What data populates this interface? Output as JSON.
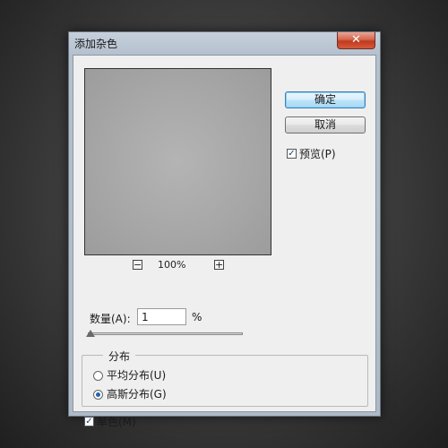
{
  "dialog": {
    "title": "添加杂色",
    "close_glyph": "✕"
  },
  "buttons": {
    "ok": "确定",
    "cancel": "取消"
  },
  "preview": {
    "checkbox_label": "预览(P)",
    "checked": true,
    "zoom_level": "100%",
    "zoom_out_glyph": "−",
    "zoom_in_glyph": "+"
  },
  "amount": {
    "label": "数量(A):",
    "value": "1",
    "unit": "%",
    "slider_fraction": 0.0025
  },
  "distribution": {
    "legend": "分布",
    "options": [
      {
        "label": "平均分布(U)",
        "selected": false
      },
      {
        "label": "高斯分布(G)",
        "selected": true
      }
    ]
  },
  "monochromatic": {
    "label": "单色(M)",
    "checked": true
  },
  "check_glyph": "✓"
}
